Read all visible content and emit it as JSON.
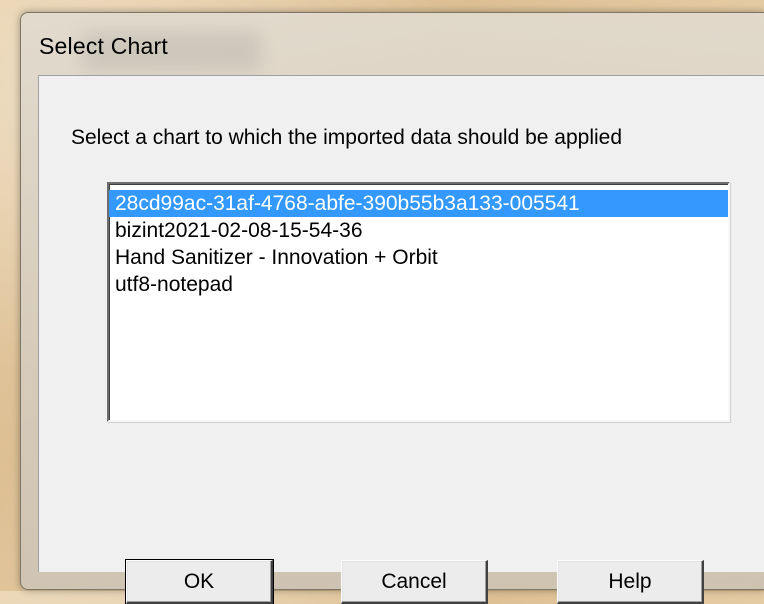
{
  "dialog": {
    "title": "Select Chart",
    "prompt": "Select a chart to which the imported data should be applied",
    "charts": [
      "28cd99ac-31af-4768-abfe-390b55b3a133-005541",
      "bizint2021-02-08-15-54-36",
      "Hand Sanitizer - Innovation + Orbit",
      "utf8-notepad"
    ],
    "selected_index": 0,
    "buttons": {
      "ok": "OK",
      "cancel": "Cancel",
      "help": "Help"
    }
  },
  "colors": {
    "selection": "#3399ff",
    "client_bg": "#f0f0f0"
  }
}
